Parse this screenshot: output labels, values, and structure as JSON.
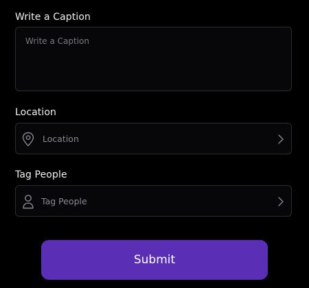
{
  "caption": {
    "label": "Write a Caption",
    "placeholder": "Write a Caption",
    "value": ""
  },
  "location": {
    "label": "Location",
    "placeholder": "Location",
    "icon": "map-pin-icon"
  },
  "tag_people": {
    "label": "Tag People",
    "placeholder": "Tag People",
    "icon": "person-icon"
  },
  "submit": {
    "label": "Submit"
  },
  "colors": {
    "background": "#000000",
    "field_border": "#2c2c30",
    "placeholder": "#8a8a90",
    "accent": "#5b2fb5",
    "text": "#ffffff"
  }
}
